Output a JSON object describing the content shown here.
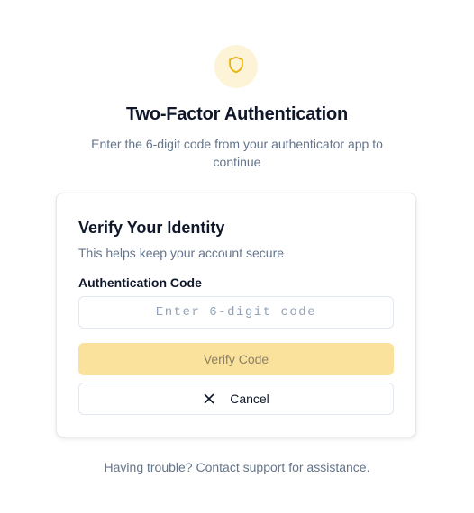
{
  "header": {
    "icon": "shield-icon",
    "title": "Two-Factor Authentication",
    "subtitle": "Enter the 6-digit code from your authenticator app to continue"
  },
  "card": {
    "title": "Verify Your Identity",
    "description": "This helps keep your account secure",
    "code_field": {
      "label": "Authentication Code",
      "placeholder": "Enter 6-digit code",
      "value": ""
    },
    "verify_button": {
      "label": "Verify Code",
      "disabled": true
    },
    "cancel_button": {
      "label": "Cancel",
      "icon": "close-icon"
    }
  },
  "footer": {
    "help_text": "Having trouble? Contact support for assistance."
  },
  "colors": {
    "accent": "#f5c518",
    "accent_soft": "#fdf3d7",
    "button_disabled_bg": "#fbe29c",
    "text_primary": "#0f172a",
    "text_muted": "#64748b"
  }
}
